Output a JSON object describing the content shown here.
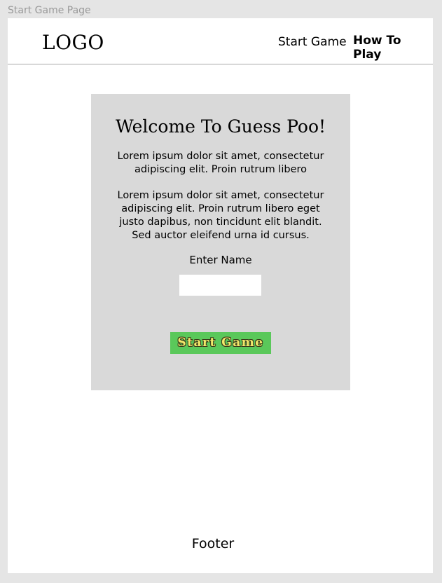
{
  "frame_label": "Start Game Page",
  "header": {
    "logo": "LOGO",
    "nav": {
      "start_game": "Start Game",
      "how_to_play": "How To Play"
    }
  },
  "panel": {
    "title": "Welcome To Guess Poo!",
    "paragraph_1": "Lorem ipsum dolor sit amet, consectetur adipiscing elit. Proin rutrum libero",
    "paragraph_2": "Lorem ipsum dolor sit amet, consectetur adipiscing elit. Proin rutrum libero eget justo dapibus, non tincidunt elit blandit. Sed auctor eleifend urna id cursus.",
    "name_label": "Enter Name",
    "name_value": "",
    "name_placeholder": "",
    "start_button_label": "Start Game",
    "start_button_color": "#5ac85a"
  },
  "footer": {
    "text": "Footer"
  }
}
